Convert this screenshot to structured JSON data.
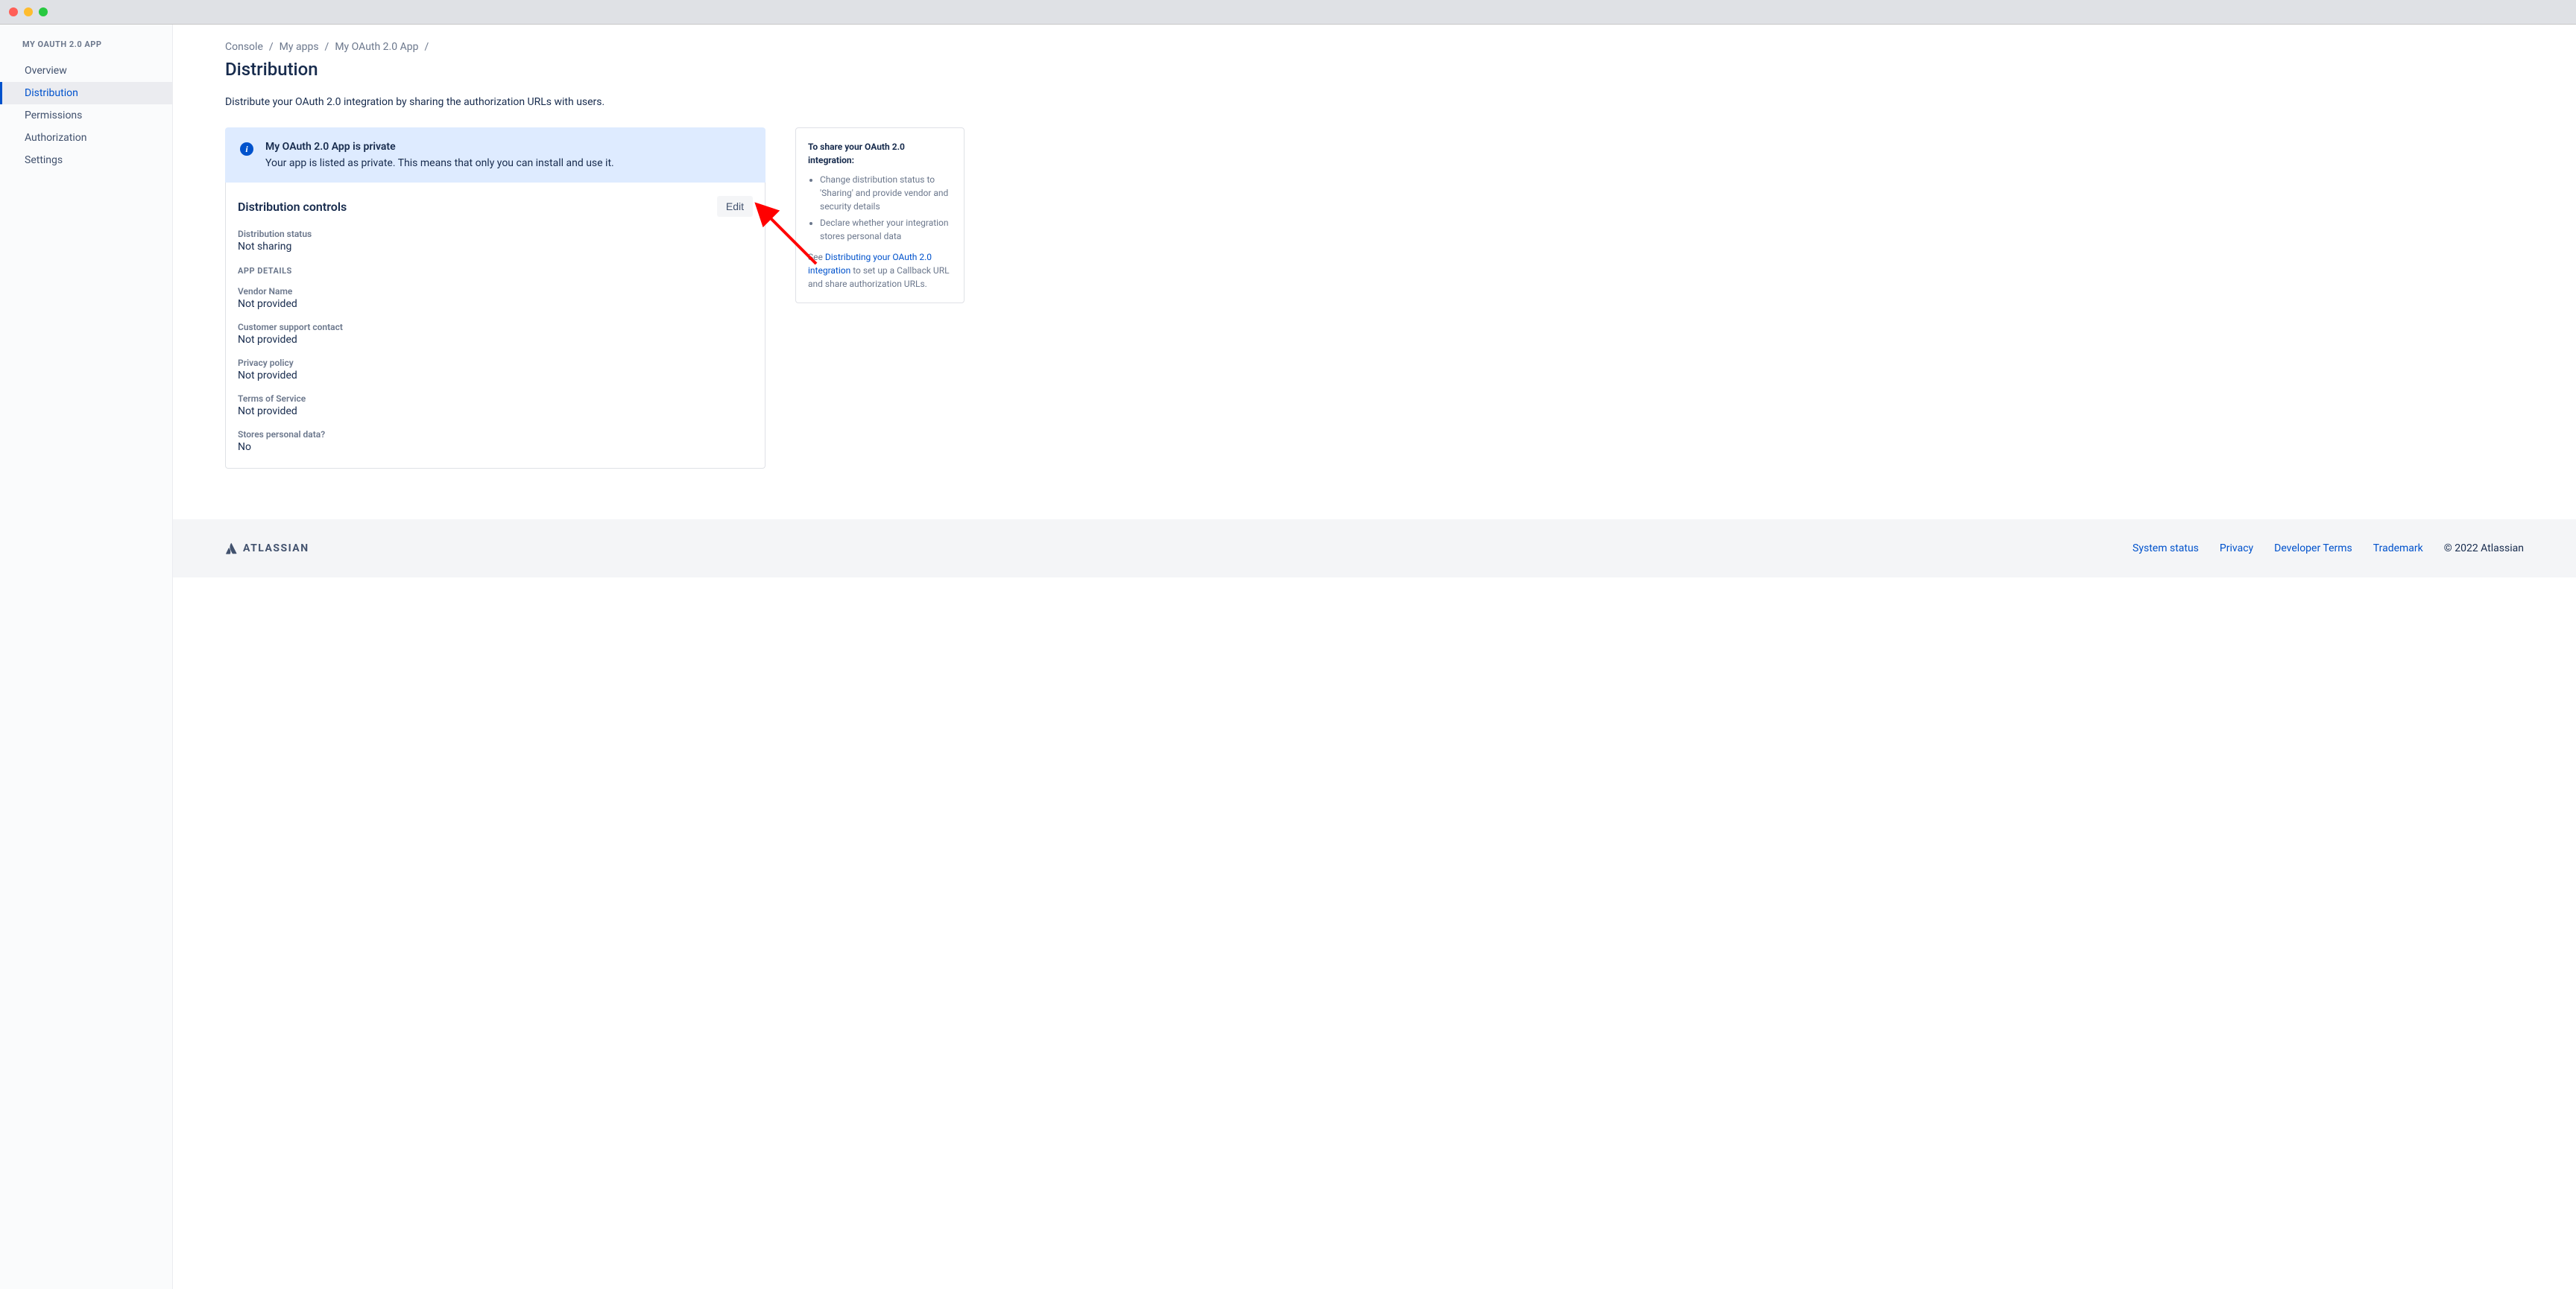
{
  "sidebar": {
    "title": "MY OAUTH 2.0 APP",
    "items": [
      {
        "label": "Overview",
        "active": false
      },
      {
        "label": "Distribution",
        "active": true
      },
      {
        "label": "Permissions",
        "active": false
      },
      {
        "label": "Authorization",
        "active": false
      },
      {
        "label": "Settings",
        "active": false
      }
    ]
  },
  "breadcrumb": [
    {
      "label": "Console"
    },
    {
      "label": "My apps"
    },
    {
      "label": "My OAuth 2.0 App"
    }
  ],
  "page": {
    "title": "Distribution",
    "description": "Distribute your OAuth 2.0 integration by sharing the authorization URLs with users."
  },
  "banner": {
    "title": "My OAuth 2.0 App is private",
    "body": "Your app is listed as private. This means that only you can install and use it."
  },
  "card": {
    "title": "Distribution controls",
    "edit_label": "Edit",
    "status_label": "Distribution status",
    "status_value": "Not sharing",
    "section_label": "APP DETAILS",
    "fields": [
      {
        "label": "Vendor Name",
        "value": "Not provided"
      },
      {
        "label": "Customer support contact",
        "value": "Not provided"
      },
      {
        "label": "Privacy policy",
        "value": "Not provided"
      },
      {
        "label": "Terms of Service",
        "value": "Not provided"
      },
      {
        "label": "Stores personal data?",
        "value": "No"
      }
    ]
  },
  "side": {
    "title": "To share your OAuth 2.0 integration:",
    "bullets": [
      "Change distribution status to 'Sharing' and provide vendor and security details",
      "Declare whether your integration stores personal data"
    ],
    "see_prefix": "See ",
    "see_link": "Distributing your OAuth 2.0 integration",
    "see_suffix": " to set up a Callback URL and share authorization URLs."
  },
  "footer": {
    "brand": "ATLASSIAN",
    "links": [
      "System status",
      "Privacy",
      "Developer Terms",
      "Trademark"
    ],
    "copyright": "© 2022 Atlassian"
  }
}
